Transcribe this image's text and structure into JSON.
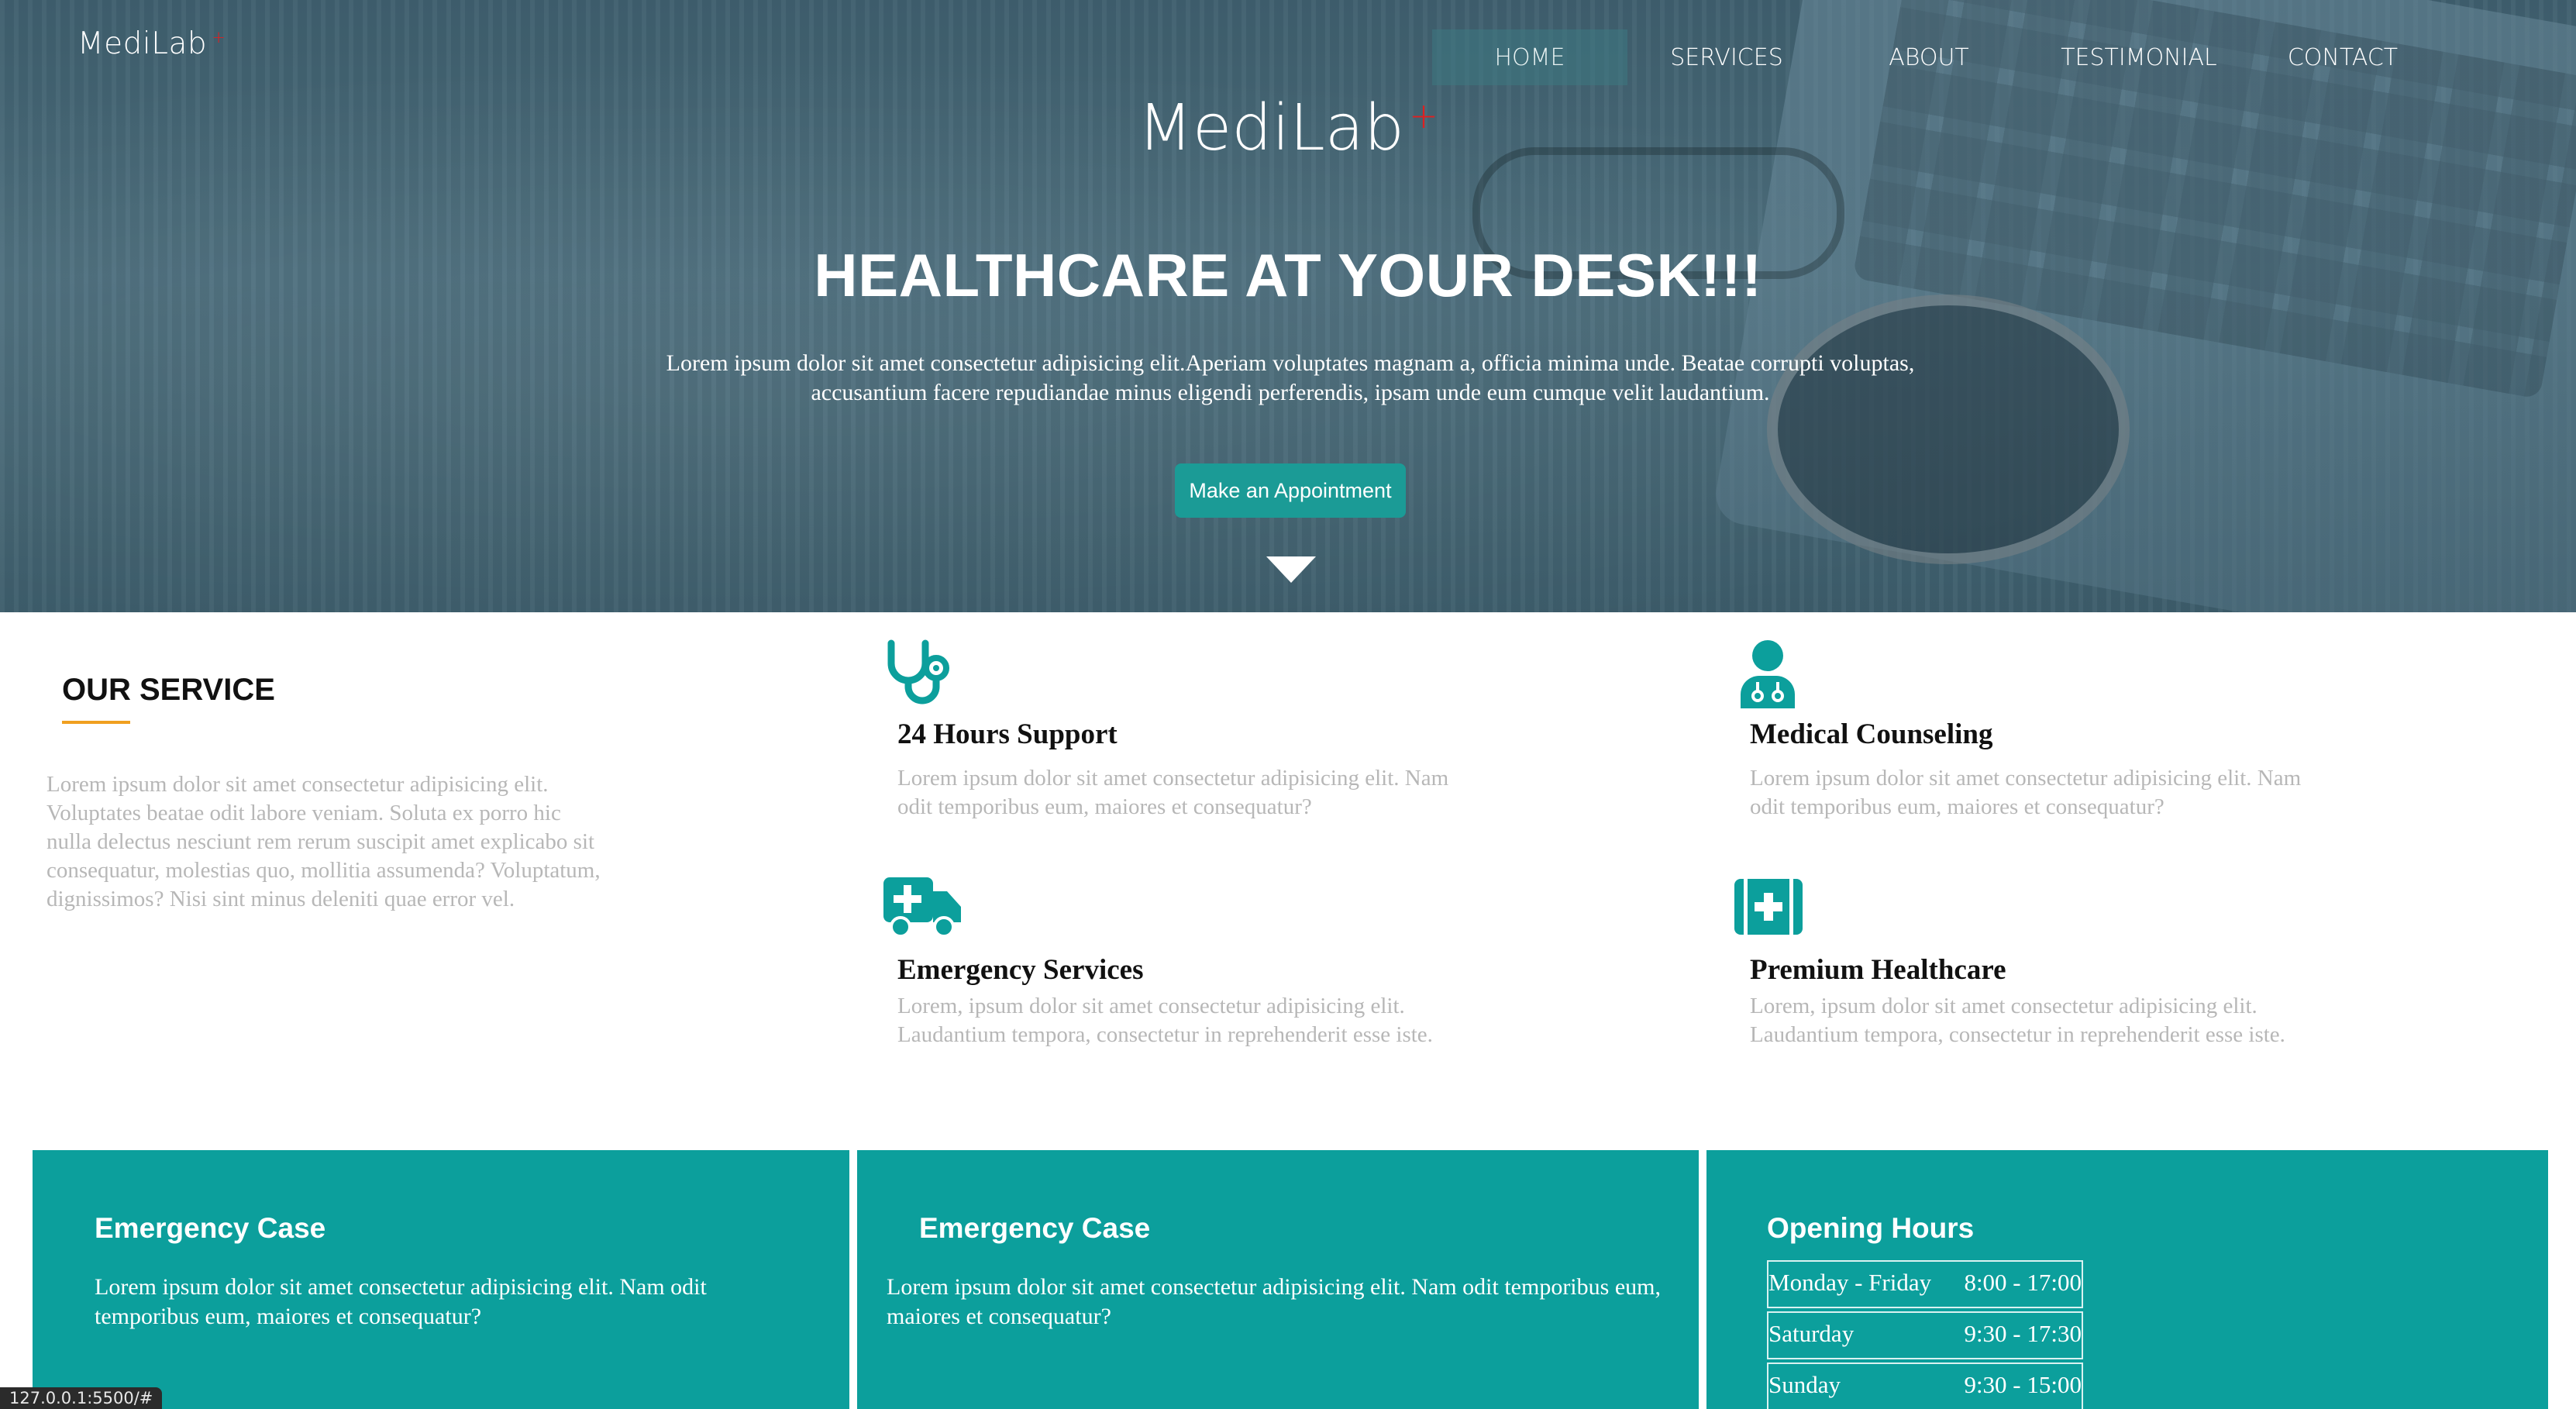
{
  "header": {
    "brand": "MediLab",
    "brand_mark": "+",
    "nav": [
      {
        "label": "HOME",
        "active": true
      },
      {
        "label": "SERVICES",
        "active": false
      },
      {
        "label": "ABOUT",
        "active": false
      },
      {
        "label": "TESTIMONIAL",
        "active": false
      },
      {
        "label": "CONTACT",
        "active": false
      }
    ]
  },
  "hero": {
    "brand": "MediLab",
    "brand_mark": "+",
    "title": "HEALTHCARE AT YOUR DESK!!!",
    "text": "Lorem ipsum dolor sit amet consectetur adipisicing elit.Aperiam voluptates magnam a, officia minima unde. Beatae corrupti voluptas, accusantium facere repudiandae minus eligendi perferendis, ipsam unde eum cumque velit laudantium.",
    "cta_label": "Make an Appointment"
  },
  "services": {
    "heading": "OUR SERVICE",
    "intro": "Lorem ipsum dolor sit amet consectetur adipisicing elit. Voluptates beatae odit labore veniam. Soluta ex porro hic nulla delectus nesciunt rem rerum suscipit amet explicabo sit consequatur, molestias quo, mollitia assumenda? Voluptatum, dignissimos? Nisi sint minus deleniti quae error vel.",
    "items": [
      {
        "icon": "stethoscope-icon",
        "title": "24 Hours Support",
        "desc": "Lorem ipsum dolor sit amet consectetur adipisicing elit. Nam odit temporibus eum, maiores et consequatur?"
      },
      {
        "icon": "doctor-icon",
        "title": "Medical Counseling",
        "desc": "Lorem ipsum dolor sit amet consectetur adipisicing elit. Nam odit temporibus eum, maiores et consequatur?"
      },
      {
        "icon": "ambulance-icon",
        "title": "Emergency Services",
        "desc": "Lorem, ipsum dolor sit amet consectetur adipisicing elit. Laudantium tempora, consectetur in reprehenderit esse iste."
      },
      {
        "icon": "medkit-icon",
        "title": "Premium Healthcare",
        "desc": "Lorem, ipsum dolor sit amet consectetur adipisicing elit. Laudantium tempora, consectetur in reprehenderit esse iste."
      }
    ]
  },
  "panels": [
    {
      "title": "Emergency Case",
      "text": "Lorem ipsum dolor sit amet consectetur adipisicing elit. Nam odit temporibus eum, maiores et consequatur?"
    },
    {
      "title": "Emergency Case",
      "text": "Lorem ipsum dolor sit amet consectetur adipisicing elit. Nam odit temporibus eum, maiores et consequatur?"
    },
    {
      "title": "Opening Hours",
      "hours": [
        {
          "day": "Monday - Friday",
          "time": "8:00 - 17:00"
        },
        {
          "day": "Saturday",
          "time": "9:30 - 17:30"
        },
        {
          "day": "Sunday",
          "time": "9:30 - 15:00"
        }
      ]
    }
  ],
  "status_bar": {
    "url": "127.0.0.1:5500/#"
  },
  "colors": {
    "accent": "#0c9f9c",
    "button": "#1b9b96",
    "underline": "#f0a020",
    "brand_mark": "#e02020"
  }
}
